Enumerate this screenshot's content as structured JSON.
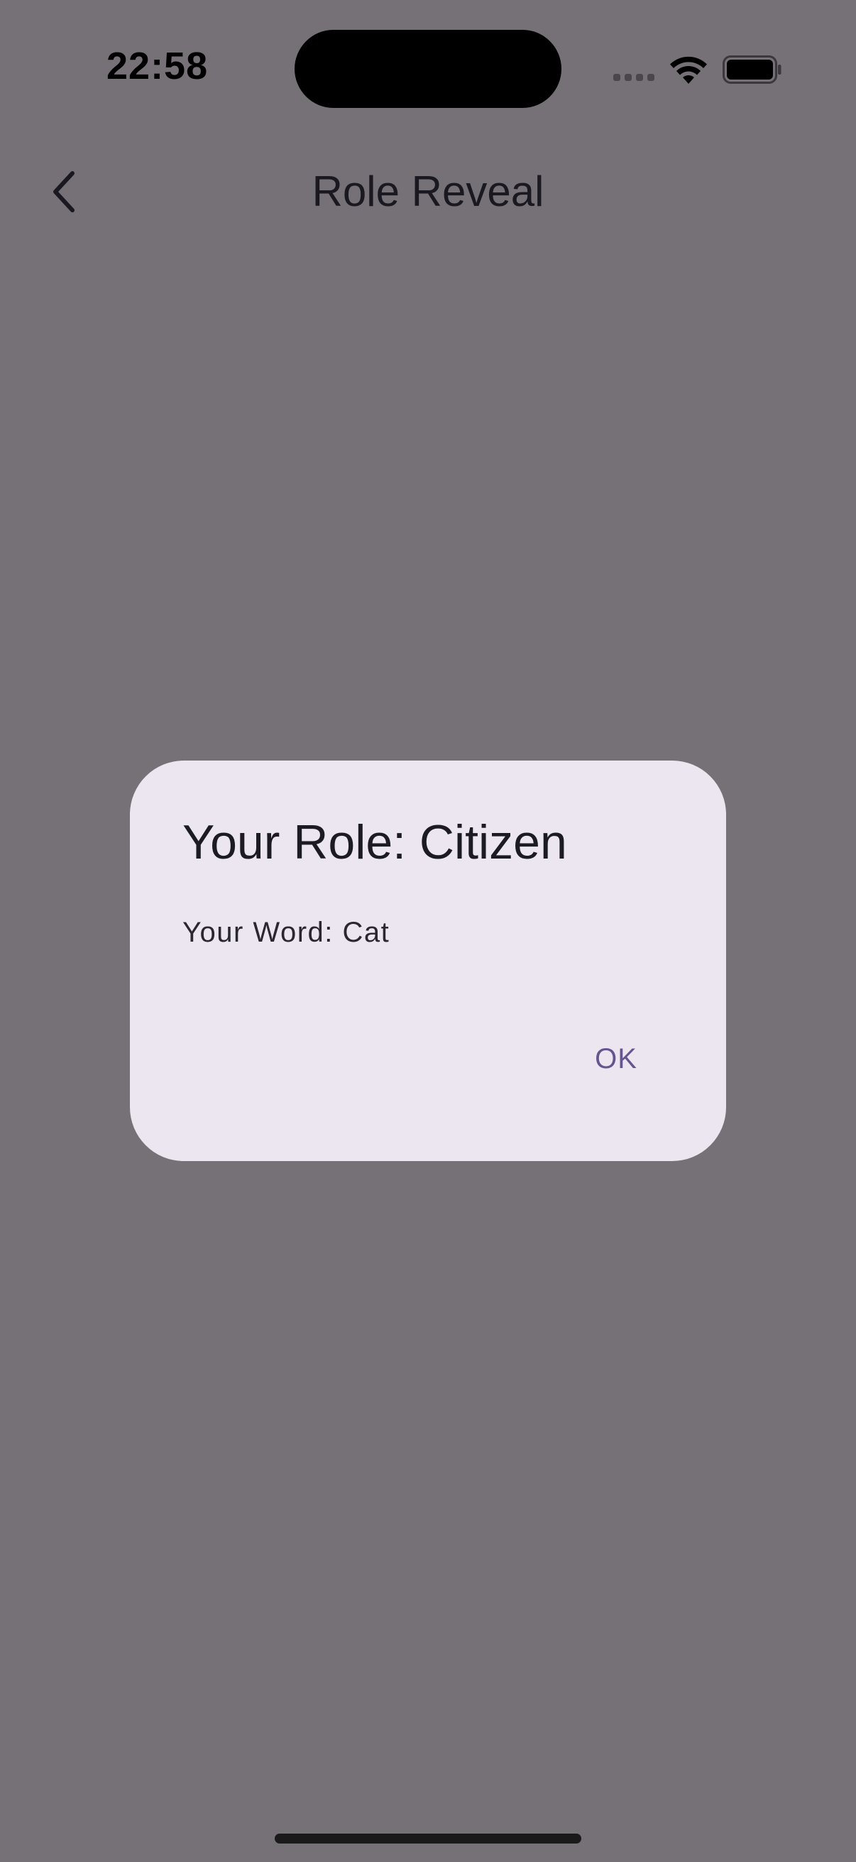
{
  "status_bar": {
    "time": "22:58",
    "icons": [
      "cellular-signal-icon",
      "wifi-icon",
      "battery-icon"
    ]
  },
  "nav": {
    "back_icon": "chevron-left-icon",
    "title": "Role Reveal"
  },
  "dialog": {
    "title": "Your Role: Citizen",
    "body": "Your Word: Cat",
    "ok_label": "OK"
  },
  "colors": {
    "scrim": "#767176",
    "dialog_background": "#ece6f0",
    "accent": "#65558f"
  }
}
